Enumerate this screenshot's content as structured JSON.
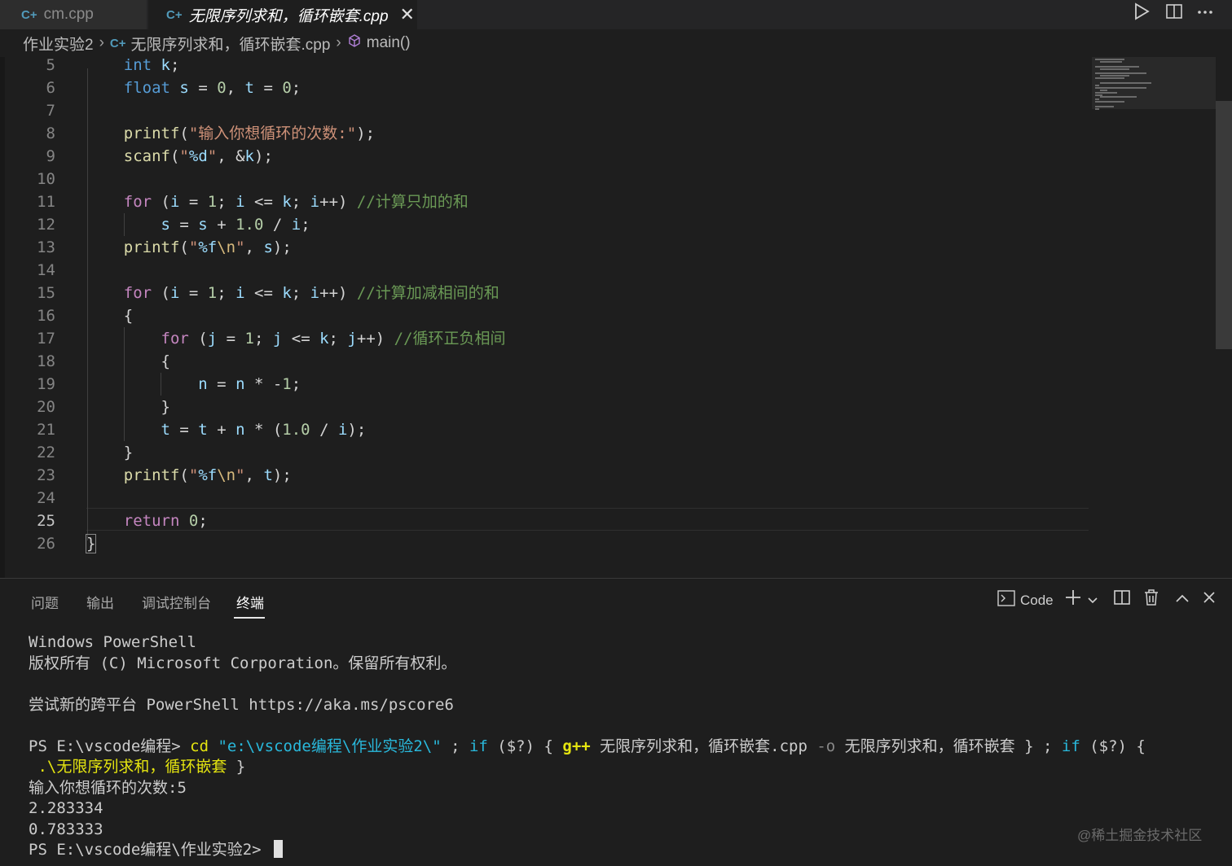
{
  "tabs": [
    {
      "icon": "C+",
      "label": "cm.cpp"
    },
    {
      "icon": "C+",
      "label": "无限序列求和，循环嵌套.cpp",
      "close": "✕"
    }
  ],
  "breadcrumb": {
    "folder": "作业实验2",
    "sep": "›",
    "file_icon": "C+",
    "file": "无限序列求和，循环嵌套.cpp",
    "symbol": "main()"
  },
  "code_lines": [
    {
      "n": "5",
      "text": "    int k;"
    },
    {
      "n": "6",
      "text": "    float s = 0, t = 0;"
    },
    {
      "n": "7",
      "text": ""
    },
    {
      "n": "8",
      "text": "    printf(\"输入你想循环的次数:\");"
    },
    {
      "n": "9",
      "text": "    scanf(\"%d\", &k);"
    },
    {
      "n": "10",
      "text": ""
    },
    {
      "n": "11",
      "text": "    for (i = 1; i <= k; i++) //计算只加的和"
    },
    {
      "n": "12",
      "text": "        s = s + 1.0 / i;"
    },
    {
      "n": "13",
      "text": "    printf(\"%f\\n\", s);"
    },
    {
      "n": "14",
      "text": ""
    },
    {
      "n": "15",
      "text": "    for (i = 1; i <= k; i++) //计算加减相间的和"
    },
    {
      "n": "16",
      "text": "    {"
    },
    {
      "n": "17",
      "text": "        for (j = 1; j <= k; j++) //循环正负相间"
    },
    {
      "n": "18",
      "text": "        {"
    },
    {
      "n": "19",
      "text": "            n = n * -1;"
    },
    {
      "n": "20",
      "text": "        }"
    },
    {
      "n": "21",
      "text": "        t = t + n * (1.0 / i);"
    },
    {
      "n": "22",
      "text": "    }"
    },
    {
      "n": "23",
      "text": "    printf(\"%f\\n\", t);"
    },
    {
      "n": "24",
      "text": ""
    },
    {
      "n": "25",
      "text": "    return 0;"
    },
    {
      "n": "26",
      "text": "}"
    }
  ],
  "panel": {
    "tabs": [
      "问题",
      "输出",
      "调试控制台",
      "终端"
    ],
    "active_tab": "终端",
    "shell_label": "Code"
  },
  "terminal": {
    "l1": "Windows PowerShell",
    "l2": "版权所有 (C) Microsoft Corporation。保留所有权利。",
    "l3": "尝试新的跨平台 PowerShell https://aka.ms/pscore6",
    "prompt1": "PS E:\\vscode编程> ",
    "cmd_cd": "cd",
    "cmd_path": " \"e:\\vscode编程\\作业实验2\\\"",
    "cmd_semicolon": " ; ",
    "cmd_if": "if",
    "cmd_cond": " ($?) { ",
    "cmd_gpp": "g++",
    "cmd_src": " 无限序列求和，循环嵌套.cpp ",
    "cmd_o": "-o",
    "cmd_out": " 无限序列求和，循环嵌套 } ; ",
    "cmd_if2": "if",
    "cmd_cond2": " ($?) {",
    "cmd_run": " .\\无限序列求和，循环嵌套",
    "cmd_close": " }",
    "out1": "输入你想循环的次数:5",
    "out2": "2.283334",
    "out3": "0.783333",
    "prompt2": "PS E:\\vscode编程\\作业实验2> "
  },
  "watermark": "@稀土掘金技术社区"
}
